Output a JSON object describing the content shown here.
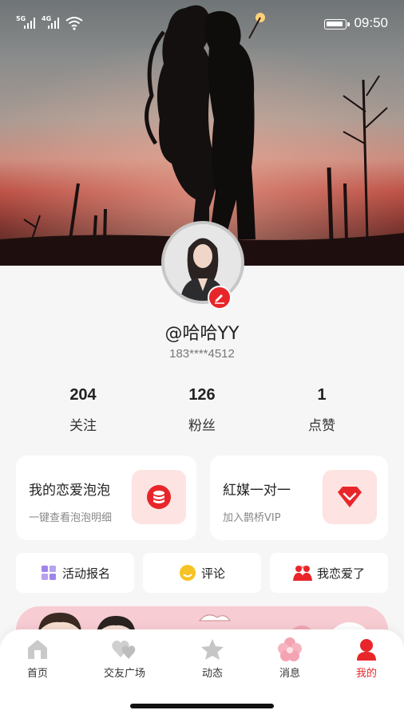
{
  "status_bar": {
    "signal1": "5G",
    "signal2": "4G",
    "time": "09:50"
  },
  "profile": {
    "name": "@哈哈YY",
    "phone": "183****4512"
  },
  "stats": [
    {
      "value": "204",
      "label": "关注"
    },
    {
      "value": "126",
      "label": "粉丝"
    },
    {
      "value": "1",
      "label": "点赞"
    }
  ],
  "cards": [
    {
      "title": "我的恋爱泡泡",
      "subtitle": "一键查看泡泡明细",
      "icon": "coins-icon"
    },
    {
      "title": "紅媒一对一",
      "subtitle": "加入鹊桥VIP",
      "icon": "diamond-icon"
    }
  ],
  "quick_actions": [
    {
      "label": "活动报名",
      "icon": "gift-icon"
    },
    {
      "label": "评论",
      "icon": "smile-icon"
    },
    {
      "label": "我恋爱了",
      "icon": "couple-icon"
    }
  ],
  "tabs": [
    {
      "label": "首页",
      "icon": "home-icon",
      "active": false
    },
    {
      "label": "交友广场",
      "icon": "hearts-icon",
      "active": false
    },
    {
      "label": "动态",
      "icon": "star-icon",
      "active": false
    },
    {
      "label": "消息",
      "icon": "flower-icon",
      "active": false
    },
    {
      "label": "我的",
      "icon": "user-icon",
      "active": true
    }
  ],
  "colors": {
    "accent": "#e8262a",
    "card_icon_bg": "#fde3e2",
    "page_bg": "#f6f6f6"
  }
}
